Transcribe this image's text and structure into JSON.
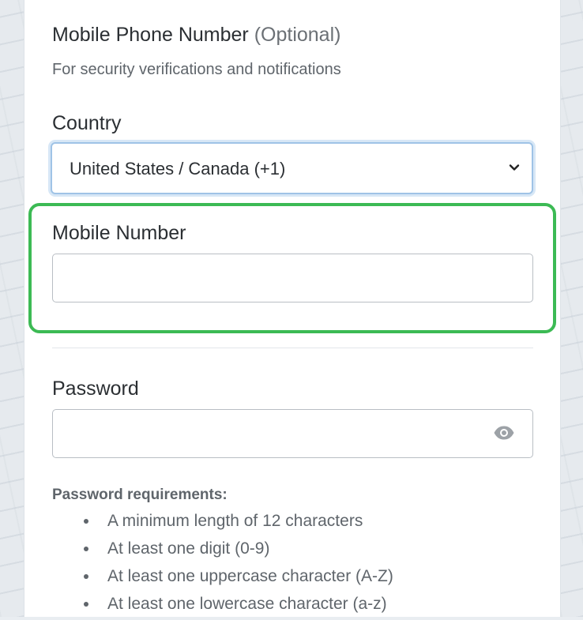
{
  "phone_section": {
    "title": "Mobile Phone Number",
    "optional": "(Optional)",
    "subtitle": "For security verifications and notifications"
  },
  "country": {
    "label": "Country",
    "selected": "United States / Canada (+1)"
  },
  "mobile_number": {
    "label": "Mobile Number",
    "value": "",
    "highlight_color": "#3cba54"
  },
  "password": {
    "label": "Password",
    "value": "",
    "toggle_icon": "eye-icon"
  },
  "requirements": {
    "title": "Password requirements:",
    "items": [
      "A minimum length of 12 characters",
      "At least one digit (0-9)",
      "At least one uppercase character (A-Z)",
      "At least one lowercase character (a-z)"
    ]
  }
}
